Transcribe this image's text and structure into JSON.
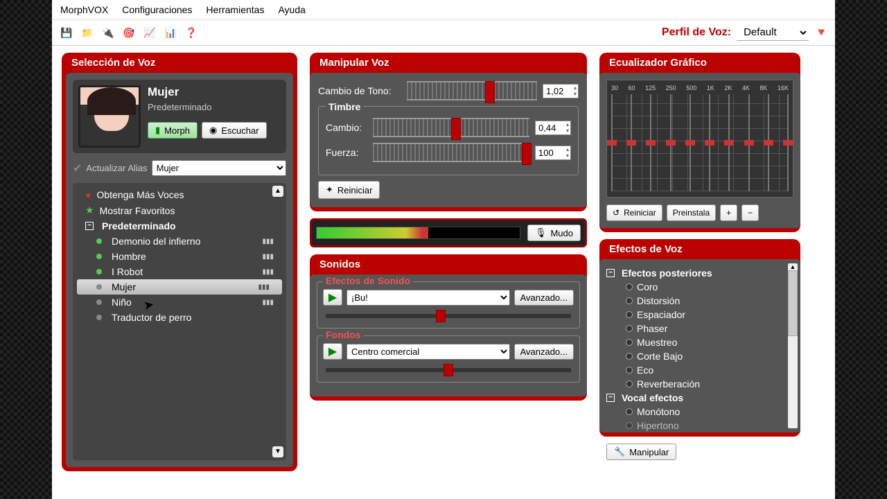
{
  "menu": {
    "items": [
      "MorphVOX",
      "Configuraciones",
      "Herramientas",
      "Ayuda"
    ]
  },
  "profile": {
    "label": "Perfil de Voz:",
    "value": "Default"
  },
  "panels": {
    "voice_selection": "Selección de Voz",
    "manipulate": "Manipular Voz",
    "equalizer": "Ecualizador Gráfico",
    "sounds": "Sonidos",
    "effects": "Efectos de Voz"
  },
  "voice": {
    "name": "Mujer",
    "subtitle": "Predeterminado",
    "morph_btn": "Morph",
    "listen_btn": "Escuchar",
    "alias_label": "Actualizar Alias",
    "alias_value": "Mujer",
    "more_voices": "Obtenga Más Voces",
    "show_favs": "Mostrar Favoritos",
    "category": "Predeterminado",
    "items": [
      {
        "label": "Demonio del infierno",
        "on": true
      },
      {
        "label": "Hombre",
        "on": true
      },
      {
        "label": "I Robot",
        "on": true
      },
      {
        "label": "Mujer",
        "on": false,
        "selected": true
      },
      {
        "label": "Niño",
        "on": false
      },
      {
        "label": "Traductor de perro",
        "on": false
      }
    ]
  },
  "manip": {
    "pitch_label": "Cambio de Tono:",
    "pitch_value": "1,02",
    "timbre_title": "Timbre",
    "shift_label": "Cambio:",
    "shift_value": "0,44",
    "strength_label": "Fuerza:",
    "strength_value": "100",
    "reset": "Reiniciar",
    "mute": "Mudo"
  },
  "eq": {
    "bands": [
      "30",
      "60",
      "125",
      "250",
      "500",
      "1K",
      "2K",
      "4K",
      "8K",
      "16K"
    ],
    "reset": "Reiniciar",
    "preset": "Preinstala",
    "plus": "+",
    "minus": "−"
  },
  "sounds": {
    "sfx_title": "Efectos de Sonido",
    "sfx_value": "¡Bu!",
    "advanced": "Avanzado...",
    "bg_title": "Fondos",
    "bg_value": "Centro comercial"
  },
  "fx": {
    "cat1": "Efectos posteriores",
    "items1": [
      "Coro",
      "Distorsión",
      "Espaciador",
      "Phaser",
      "Muestreo",
      "Corte Bajo",
      "Eco",
      "Reverberación"
    ],
    "cat2": "Vocal efectos",
    "items2": [
      "Monótono",
      "Hipertono"
    ],
    "manipulate": "Manipular"
  }
}
